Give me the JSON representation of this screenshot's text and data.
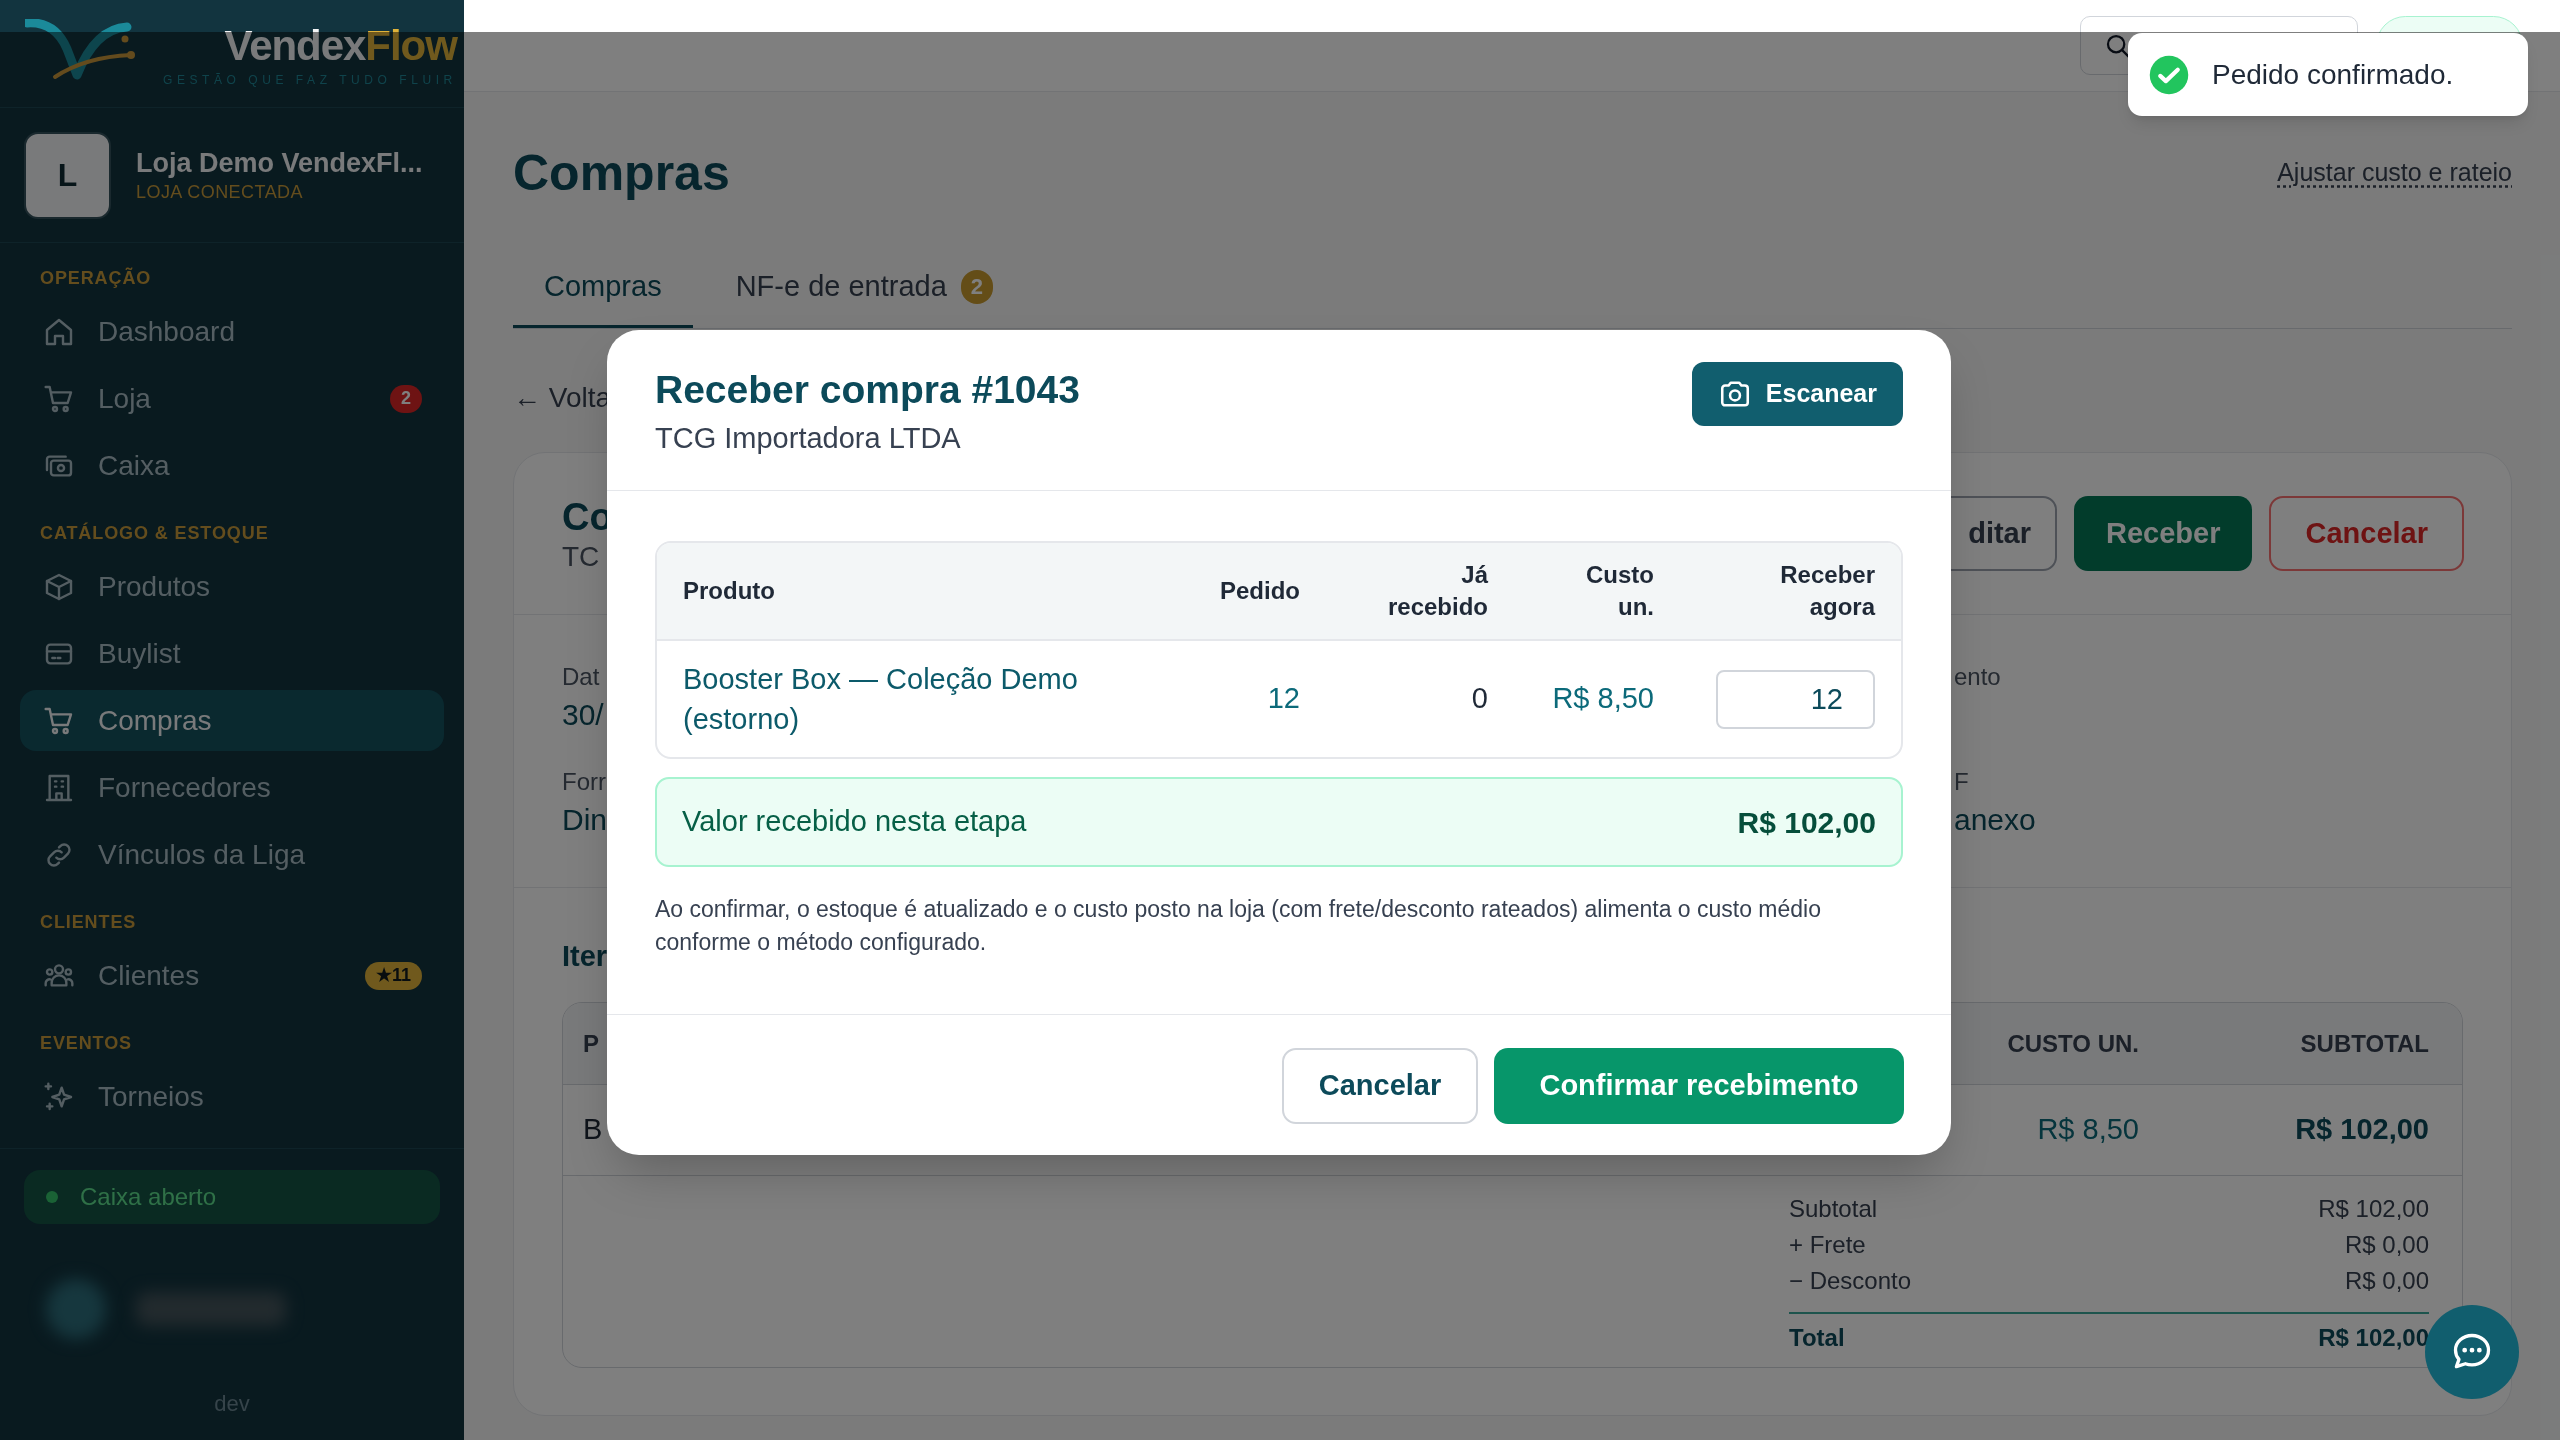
{
  "sidebar": {
    "brand": {
      "name_start": "Vendex",
      "name_end": "Flow",
      "tagline": "GESTÃO QUE FAZ TUDO FLUIR"
    },
    "store": {
      "initial": "L",
      "name": "Loja Demo VendexFl...",
      "status": "LOJA CONECTADA"
    },
    "sections": [
      {
        "title": "OPERAÇÃO",
        "items": [
          {
            "label": "Dashboard",
            "selected": false
          },
          {
            "label": "Loja",
            "selected": false,
            "badge": {
              "text": "2",
              "kind": "alert"
            }
          },
          {
            "label": "Caixa",
            "selected": false
          }
        ]
      },
      {
        "title": "CATÁLOGO & ESTOQUE",
        "items": [
          {
            "label": "Produtos",
            "selected": false
          },
          {
            "label": "Buylist",
            "selected": false
          },
          {
            "label": "Compras",
            "selected": true
          },
          {
            "label": "Fornecedores",
            "selected": false
          },
          {
            "label": "Vínculos da Liga",
            "selected": false
          }
        ]
      },
      {
        "title": "CLIENTES",
        "items": [
          {
            "label": "Clientes",
            "selected": false,
            "badge": {
              "text": "★11",
              "kind": "loyalty"
            }
          }
        ]
      },
      {
        "title": "EVENTOS",
        "items": [
          {
            "label": "Torneios",
            "selected": false
          }
        ]
      }
    ],
    "cash_register": {
      "label": "Caixa aberto",
      "open": true
    },
    "footer": "dev"
  },
  "page": {
    "title": "Compras",
    "action_link": "Ajustar custo e rateio",
    "tabs": [
      {
        "label": "Compras",
        "selected": true
      },
      {
        "label": "NF-e de entrada",
        "selected": false,
        "badge": "2"
      }
    ],
    "back_link": "← Volta",
    "purchase_card": {
      "title": "Co",
      "subtitle": "TC",
      "actions": [
        {
          "label": "ditar",
          "kind": "outline"
        },
        {
          "label": "Receber",
          "kind": "primary"
        },
        {
          "label": "Cancelar",
          "kind": "danger"
        }
      ],
      "details_left": [
        {
          "label": "Dat",
          "value": "30/"
        },
        {
          "label": "Forr",
          "value": "Din"
        }
      ],
      "details_right": [
        {
          "label": "ento"
        },
        {
          "label": "F",
          "value": "anexo"
        }
      ],
      "items_title": "Iter",
      "items_table": {
        "columns": [
          "P",
          "CUSTO UN.",
          "SUBTOTAL"
        ],
        "rows": [
          [
            "B",
            "R$ 8,50",
            "R$ 102,00"
          ]
        ]
      },
      "totals": [
        {
          "label": "Subtotal",
          "value": "R$ 102,00",
          "kind": "line"
        },
        {
          "label": "+ Frete",
          "value": "R$ 0,00",
          "kind": "line"
        },
        {
          "label": "− Desconto",
          "value": "R$ 0,00",
          "kind": "line"
        },
        {
          "label": "Total",
          "value": "R$ 102,00",
          "kind": "total"
        }
      ]
    }
  },
  "modal": {
    "title": "Receber compra #1043",
    "subtitle": "TCG Importadora LTDA",
    "scan_button": "Escanear",
    "columns": [
      "Produto",
      "Pedido",
      "Já recebido",
      "Custo un.",
      "Receber agora"
    ],
    "rows": [
      {
        "product": "Booster Box — Coleção Demo (estorno)",
        "ordered": "12",
        "received": "0",
        "unit_cost": "R$ 8,50",
        "receive_now": "12"
      }
    ],
    "summary": {
      "label": "Valor recebido nesta etapa",
      "value": "R$ 102,00"
    },
    "note": "Ao confirmar, o estoque é atualizado e o custo posto na loja (com frete/desconto rateados) alimenta o custo médio conforme o método configurado.",
    "buttons": [
      {
        "label": "Cancelar",
        "kind": "secondary"
      },
      {
        "label": "Confirmar recebimento",
        "kind": "primary"
      }
    ]
  },
  "toast": {
    "message": "Pedido confirmado.",
    "kind": "success"
  }
}
